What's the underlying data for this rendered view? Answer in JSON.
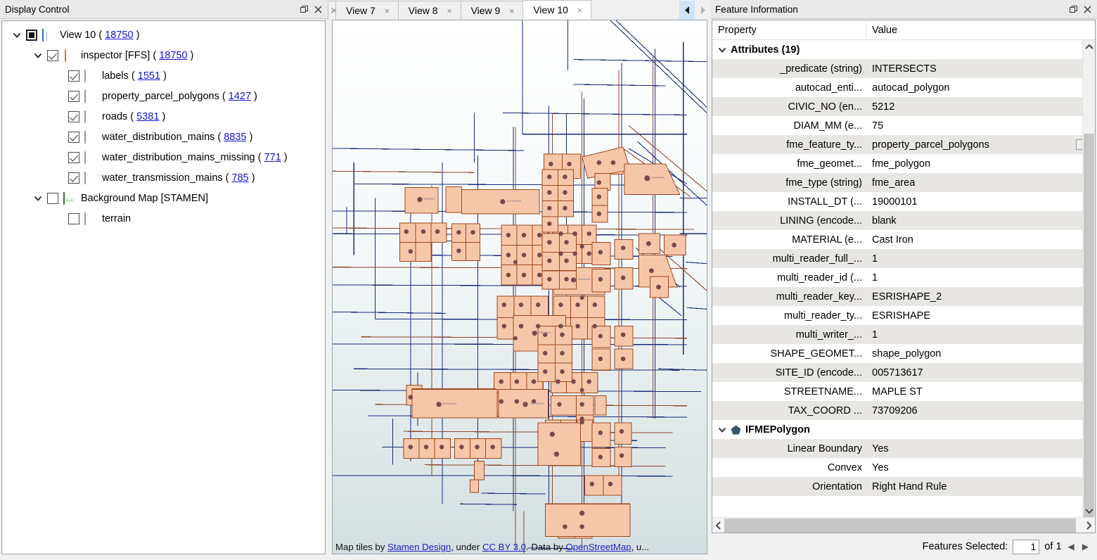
{
  "display_control": {
    "title": "Display Control",
    "float_icon": "float-icon",
    "close_icon": "close-icon",
    "tree": [
      {
        "indent": 0,
        "twisty": "expanded",
        "checkbox": "filled",
        "icon": "view-icon",
        "label": "View 10",
        "open_paren": "(",
        "count": "18750",
        "close_paren": ")"
      },
      {
        "indent": 1,
        "twisty": "expanded",
        "checkbox": "checked",
        "icon": "database-icon",
        "label": "inspector [FFS]",
        "open_paren": "(",
        "count": "18750",
        "close_paren": ")"
      },
      {
        "indent": 2,
        "twisty": "none",
        "checkbox": "checked",
        "icon": "grid-icon",
        "label": "labels",
        "open_paren": "(",
        "count": "1551",
        "close_paren": ")"
      },
      {
        "indent": 2,
        "twisty": "none",
        "checkbox": "checked",
        "icon": "grid-icon",
        "label": "property_parcel_polygons",
        "open_paren": "(",
        "count": "1427",
        "close_paren": ")"
      },
      {
        "indent": 2,
        "twisty": "none",
        "checkbox": "checked",
        "icon": "grid-icon",
        "label": "roads",
        "open_paren": "(",
        "count": "5381",
        "close_paren": ")"
      },
      {
        "indent": 2,
        "twisty": "none",
        "checkbox": "checked",
        "icon": "grid-icon",
        "label": "water_distribution_mains",
        "open_paren": "(",
        "count": "8835",
        "close_paren": ")"
      },
      {
        "indent": 2,
        "twisty": "none",
        "checkbox": "checked",
        "icon": "grid-icon",
        "label": "water_distribution_mains_missing",
        "open_paren": "(",
        "count": "771",
        "close_paren": ")"
      },
      {
        "indent": 2,
        "twisty": "none",
        "checkbox": "checked",
        "icon": "grid-icon",
        "label": "water_transmission_mains",
        "open_paren": "(",
        "count": "785",
        "close_paren": ")"
      },
      {
        "indent": 1,
        "twisty": "expanded",
        "checkbox": "unchecked",
        "icon": "terrain-map-icon",
        "label": "Background Map [STAMEN]",
        "open_paren": "",
        "count": "",
        "close_paren": ""
      },
      {
        "indent": 2,
        "twisty": "none",
        "checkbox": "unchecked",
        "icon": "grid-icon",
        "label": "terrain",
        "open_paren": "",
        "count": "",
        "close_paren": ""
      }
    ]
  },
  "view_tabs": {
    "partial_tab_label": "",
    "tabs": [
      {
        "label": "View 7",
        "active": false,
        "close": "×"
      },
      {
        "label": "View 8",
        "active": false,
        "close": "×"
      },
      {
        "label": "View 9",
        "active": false,
        "close": "×"
      },
      {
        "label": "View 10",
        "active": true,
        "close": "×"
      }
    ],
    "nav_prev_icon": "prev-tab-icon",
    "nav_next_icon": "next-tab-icon"
  },
  "map": {
    "attribution_prefix": "Map tiles by ",
    "link_stamen": "Stamen Design",
    "attribution_mid": ", under ",
    "link_ccby": "CC BY 3.0",
    "attribution_mid2": ". Data by ",
    "link_osm": "OpenStreetMap",
    "attribution_suffix": ", u...",
    "colors": {
      "parcel_fill": "#f6c6a8",
      "parcel_stroke": "#9c4a20",
      "road_line": "#1a2a7a",
      "water_line": "#7a4a3a",
      "label_dot": "#7a4a4a",
      "background_top": "#ffffff",
      "background_bottom": "#d6e0e2"
    }
  },
  "feature_information": {
    "title": "Feature Information",
    "float_icon": "float-icon",
    "close_icon": "close-icon",
    "columns": {
      "property": "Property",
      "value": "Value"
    },
    "groups": [
      {
        "name": "Attributes (19)",
        "name_plain": "Attributes",
        "count_suffix": "(19)",
        "icon": "chevron-down-icon",
        "rows": [
          {
            "property": "_predicate (string)",
            "value": "INTERSECTS"
          },
          {
            "property": "autocad_enti...",
            "value": "autocad_polygon"
          },
          {
            "property": "CIVIC_NO (en...",
            "value": "5212"
          },
          {
            "property": "DIAM_MM (e...",
            "value": "75"
          },
          {
            "property": "fme_feature_ty...",
            "value": "property_parcel_polygons",
            "has_box": true
          },
          {
            "property": "fme_geomet...",
            "value": "fme_polygon"
          },
          {
            "property": "fme_type (string)",
            "value": "fme_area"
          },
          {
            "property": "INSTALL_DT (...",
            "value": "19000101"
          },
          {
            "property": "LINING (encode...",
            "value": "blank"
          },
          {
            "property": "MATERIAL (e...",
            "value": "Cast Iron"
          },
          {
            "property": "multi_reader_full_...",
            "value": "1"
          },
          {
            "property": "multi_reader_id (...",
            "value": "1"
          },
          {
            "property": "multi_reader_key...",
            "value": "ESRISHAPE_2"
          },
          {
            "property": "multi_reader_ty...",
            "value": "ESRISHAPE"
          },
          {
            "property": "multi_writer_...",
            "value": "1"
          },
          {
            "property": "SHAPE_GEOMET...",
            "value": "shape_polygon"
          },
          {
            "property": "SITE_ID (encode...",
            "value": "005713617"
          },
          {
            "property": "STREETNAME...",
            "value": "MAPLE ST"
          },
          {
            "property": "TAX_COORD ...",
            "value": "73709206"
          }
        ]
      },
      {
        "name": "IFMEPolygon",
        "name_plain": "IFMEPolygon",
        "count_suffix": "",
        "icon": "pentagon-icon",
        "rows": [
          {
            "property": "Linear Boundary",
            "value": "Yes"
          },
          {
            "property": "Convex",
            "value": "Yes"
          },
          {
            "property": "Orientation",
            "value": "Right Hand Rule"
          }
        ]
      }
    ],
    "scroll": {
      "up_icon": "scroll-up-icon",
      "down_icon": "scroll-down-icon",
      "left_icon": "scroll-left-icon",
      "right_icon": "scroll-right-icon"
    },
    "status": {
      "label": "Features Selected:",
      "selected": "1",
      "of_text": "of 1",
      "prev_icon": "prev-feature-icon",
      "next_icon": "next-feature-icon"
    }
  }
}
